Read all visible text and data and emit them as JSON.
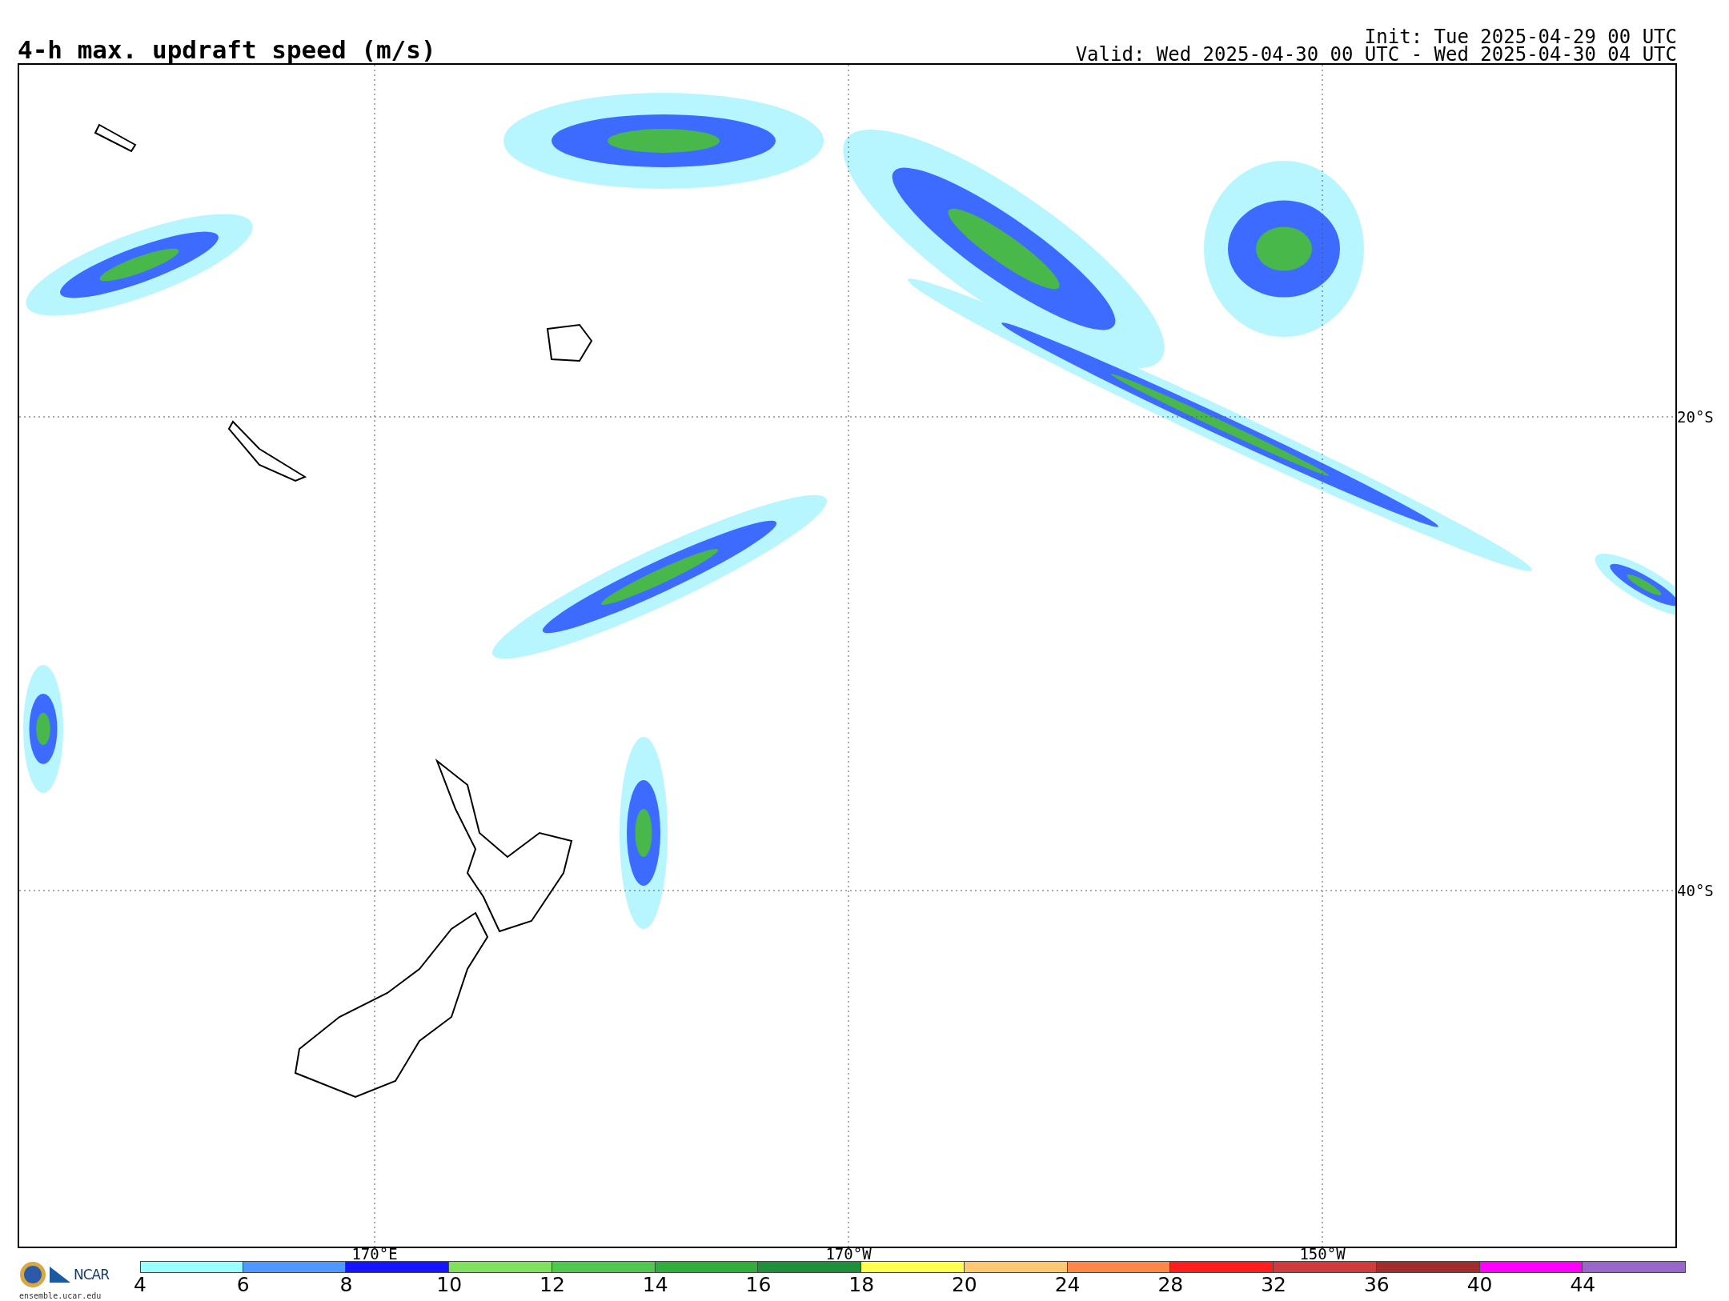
{
  "title": "4-h max. updraft speed (m/s)",
  "init": "Init: Tue 2025-04-29 00 UTC",
  "valid": "Valid: Wed 2025-04-30 00 UTC - Wed 2025-04-30 04 UTC",
  "map": {
    "lat_labels": [
      "20°S",
      "40°S"
    ],
    "lon_labels": [
      "170°E",
      "170°W",
      "150°W"
    ]
  },
  "footer": {
    "logo_text": "NCAR",
    "site": "ensemble.ucar.edu"
  },
  "colorbar": [
    {
      "tick": "4",
      "color": "#99ffff"
    },
    {
      "tick": "6",
      "color": "#4f98ff"
    },
    {
      "tick": "8",
      "color": "#1414ff"
    },
    {
      "tick": "10",
      "color": "#80e060"
    },
    {
      "tick": "12",
      "color": "#50c850"
    },
    {
      "tick": "14",
      "color": "#30ad3a"
    },
    {
      "tick": "16",
      "color": "#1f8f3c"
    },
    {
      "tick": "18",
      "color": "#ffff50"
    },
    {
      "tick": "20",
      "color": "#ffc870"
    },
    {
      "tick": "24",
      "color": "#ff8848"
    },
    {
      "tick": "28",
      "color": "#ff1e1e"
    },
    {
      "tick": "32",
      "color": "#d03c3c"
    },
    {
      "tick": "36",
      "color": "#a02c2c"
    },
    {
      "tick": "40",
      "color": "#ff00ff"
    },
    {
      "tick": "44",
      "color": "#9966cc"
    }
  ]
}
